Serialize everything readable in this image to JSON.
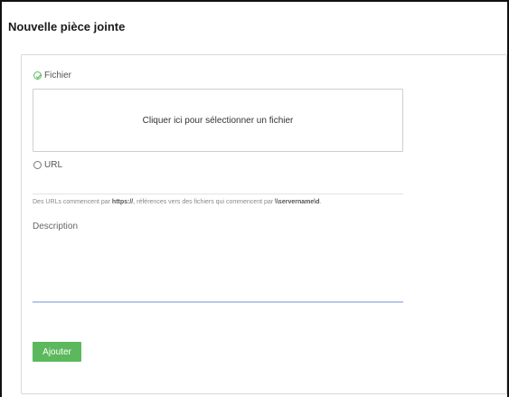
{
  "dialog": {
    "title": "Nouvelle pièce jointe"
  },
  "source": {
    "file_option_label": "Fichier",
    "file_option_selected": true,
    "drop_zone_text": "Cliquer ici pour sélectionner un fichier",
    "url_option_label": "URL",
    "url_option_selected": false,
    "help_prefix": "Des URLs commencent par ",
    "help_https": "https://",
    "help_middle": ", références vers des fichiers qui commencent par ",
    "help_server": "\\\\servername\\d",
    "help_suffix": "."
  },
  "description": {
    "label": "Description",
    "value": ""
  },
  "actions": {
    "add_label": "Ajouter"
  },
  "colors": {
    "accent_green": "#5cb85c",
    "textarea_underline": "#b9c8e8"
  },
  "icons": {
    "file_radio": "check-circle-icon",
    "url_radio": "radio-empty-icon"
  }
}
